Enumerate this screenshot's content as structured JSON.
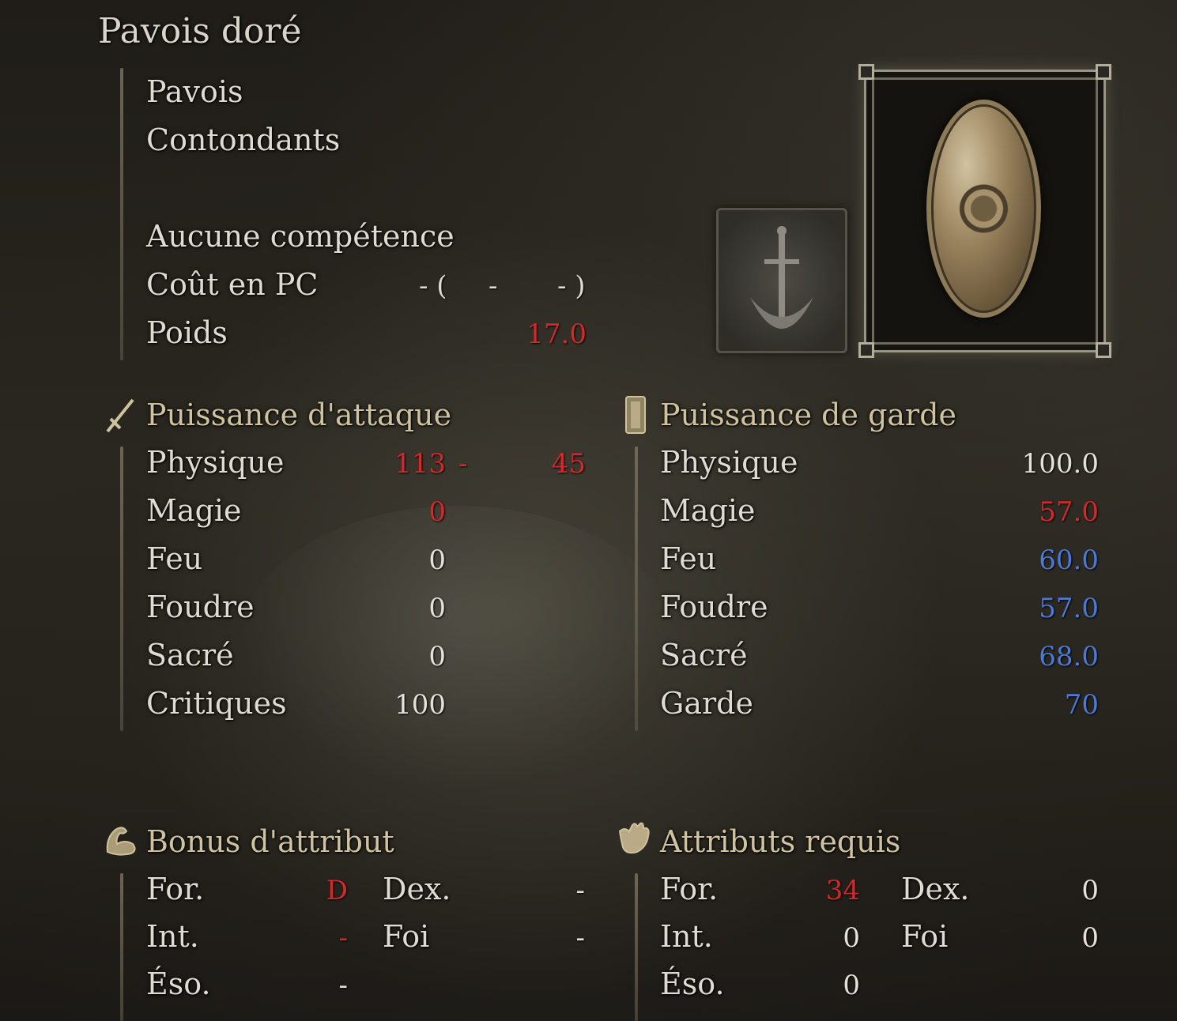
{
  "item": {
    "name": "Pavois doré",
    "type": "Pavois",
    "damage_type": "Contondants",
    "skill": "Aucune compétence",
    "fp_label": "Coût en PC",
    "fp_open": "- (",
    "fp_mid": "-",
    "fp_close": "- )",
    "weight_label": "Poids",
    "weight_value": "17.0"
  },
  "icons": {
    "attack": "sword-icon",
    "guard": "shield-icon",
    "bonus": "arm-icon",
    "requirements": "hand-icon",
    "item_image": "golden-shield-icon",
    "skill_image": "sword-emblem-icon"
  },
  "attack": {
    "title": "Puissance d'attaque",
    "rows": [
      {
        "label": "Physique",
        "value": "113",
        "sep": "-",
        "value2": "45",
        "color": "red"
      },
      {
        "label": "Magie",
        "value": "0",
        "color": "red"
      },
      {
        "label": "Feu",
        "value": "0",
        "color": "white"
      },
      {
        "label": "Foudre",
        "value": "0",
        "color": "white"
      },
      {
        "label": "Sacré",
        "value": "0",
        "color": "white"
      },
      {
        "label": "Critiques",
        "value": "100",
        "color": "white"
      }
    ]
  },
  "guard": {
    "title": "Puissance de garde",
    "rows": [
      {
        "label": "Physique",
        "value": "100.0",
        "color": "white"
      },
      {
        "label": "Magie",
        "value": "57.0",
        "color": "red"
      },
      {
        "label": "Feu",
        "value": "60.0",
        "color": "blue"
      },
      {
        "label": "Foudre",
        "value": "57.0",
        "color": "blue"
      },
      {
        "label": "Sacré",
        "value": "68.0",
        "color": "blue"
      },
      {
        "label": "Garde",
        "value": "70",
        "color": "blue"
      }
    ]
  },
  "bonus": {
    "title": "Bonus d'attribut",
    "str_label": "For.",
    "str_value": "D",
    "dex_label": "Dex.",
    "dex_value": "-",
    "int_label": "Int.",
    "int_value": "-",
    "fai_label": "Foi",
    "fai_value": "-",
    "arc_label": "Éso.",
    "arc_value": "-"
  },
  "requirements": {
    "title": "Attributs requis",
    "str_label": "For.",
    "str_value": "34",
    "dex_label": "Dex.",
    "dex_value": "0",
    "int_label": "Int.",
    "int_value": "0",
    "fai_label": "Foi",
    "fai_value": "0",
    "arc_label": "Éso.",
    "arc_value": "0"
  },
  "colors": {
    "red": "#d12a2a",
    "blue": "#4b79d6",
    "white": "#e4e1da",
    "section": "#cfc29e"
  }
}
